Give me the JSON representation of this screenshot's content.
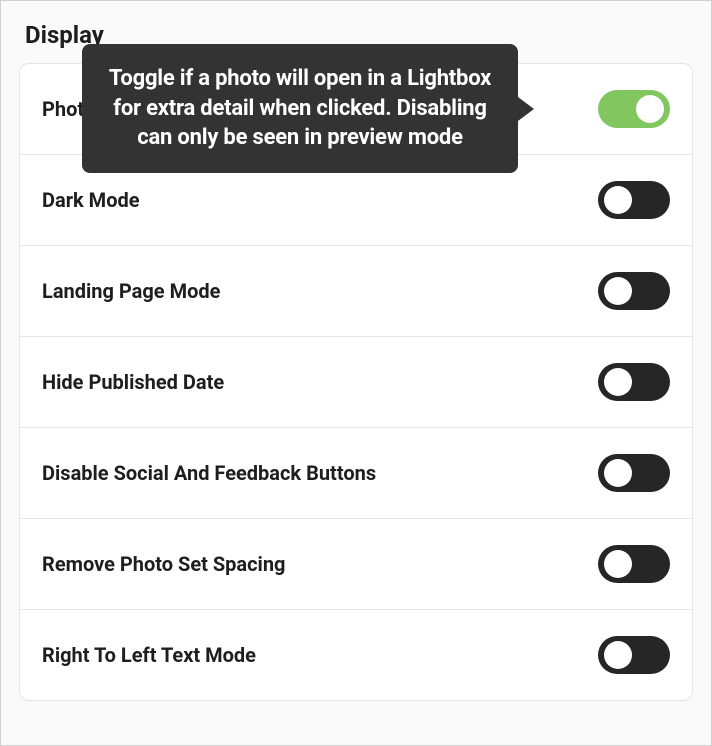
{
  "section_title": "Display",
  "tooltip": "Toggle if a photo will open in a Lightbox for extra detail when clicked. Disabling can only be seen in preview mode",
  "settings": {
    "photo_lightbox": {
      "label": "Photo Lightbox",
      "on": true
    },
    "dark_mode": {
      "label": "Dark Mode",
      "on": false
    },
    "landing_page": {
      "label": "Landing Page Mode",
      "on": false
    },
    "hide_published": {
      "label": "Hide Published Date",
      "on": false
    },
    "disable_social": {
      "label": "Disable Social And Feedback Buttons",
      "on": false
    },
    "remove_spacing": {
      "label": "Remove Photo Set Spacing",
      "on": false
    },
    "rtl_mode": {
      "label": "Right To Left Text Mode",
      "on": false
    }
  },
  "colors": {
    "toggle_on": "#82c65f",
    "toggle_off": "#262626",
    "tooltip_bg": "#333333"
  }
}
